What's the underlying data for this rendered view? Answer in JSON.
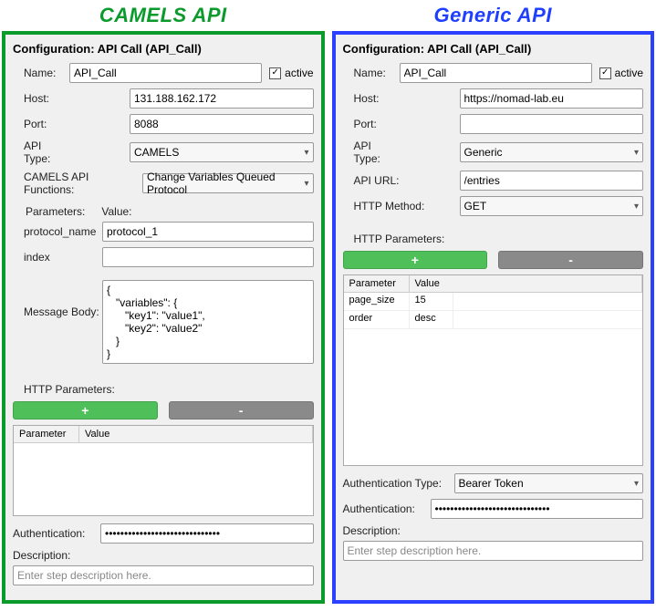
{
  "left": {
    "heading": "CAMELS API",
    "config_title": "Configuration: API Call (API_Call)",
    "name_label": "Name:",
    "name_value": "API_Call",
    "active_label": "active",
    "active_checked": "✓",
    "host_label": "Host:",
    "host_value": "131.188.162.172",
    "port_label": "Port:",
    "port_value": "8088",
    "api_type_label": "API Type:",
    "api_type_value": "CAMELS",
    "camels_fn_label": "CAMELS API Functions:",
    "camels_fn_value": "Change Variables Queued Protocol",
    "params_header_param": "Parameters:",
    "params_header_value": "Value:",
    "param1_name": "protocol_name",
    "param1_value": "protocol_1",
    "param2_name": "index",
    "param2_value": "",
    "msgbody_label": "Message Body:",
    "msgbody_value": "{\n   \"variables\": {\n      \"key1\": \"value1\",\n      \"key2\": \"value2\"\n   }\n}",
    "http_params_label": "HTTP Parameters:",
    "add_btn": "+",
    "del_btn": "-",
    "table_col_param": "Parameter",
    "table_col_value": "Value",
    "auth_label": "Authentication:",
    "auth_value": "••••••••••••••••••••••••••••••",
    "desc_label": "Description:",
    "desc_placeholder": "Enter step description here."
  },
  "right": {
    "heading": "Generic API",
    "config_title": "Configuration: API Call (API_Call)",
    "name_label": "Name:",
    "name_value": "API_Call",
    "active_label": "active",
    "active_checked": "✓",
    "host_label": "Host:",
    "host_value": "https://nomad-lab.eu",
    "port_label": "Port:",
    "port_value": "",
    "api_type_label": "API Type:",
    "api_type_value": "Generic",
    "api_url_label": "API URL:",
    "api_url_value": "/entries",
    "http_method_label": "HTTP Method:",
    "http_method_value": "GET",
    "http_params_label": "HTTP Parameters:",
    "add_btn": "+",
    "del_btn": "-",
    "table_col_param": "Parameter",
    "table_col_value": "Value",
    "rows": [
      {
        "param": "page_size",
        "value": "15"
      },
      {
        "param": "order",
        "value": "desc"
      }
    ],
    "auth_type_label": "Authentication Type:",
    "auth_type_value": "Bearer Token",
    "auth_label": "Authentication:",
    "auth_value": "••••••••••••••••••••••••••••••",
    "desc_label": "Description:",
    "desc_placeholder": "Enter step description here."
  }
}
